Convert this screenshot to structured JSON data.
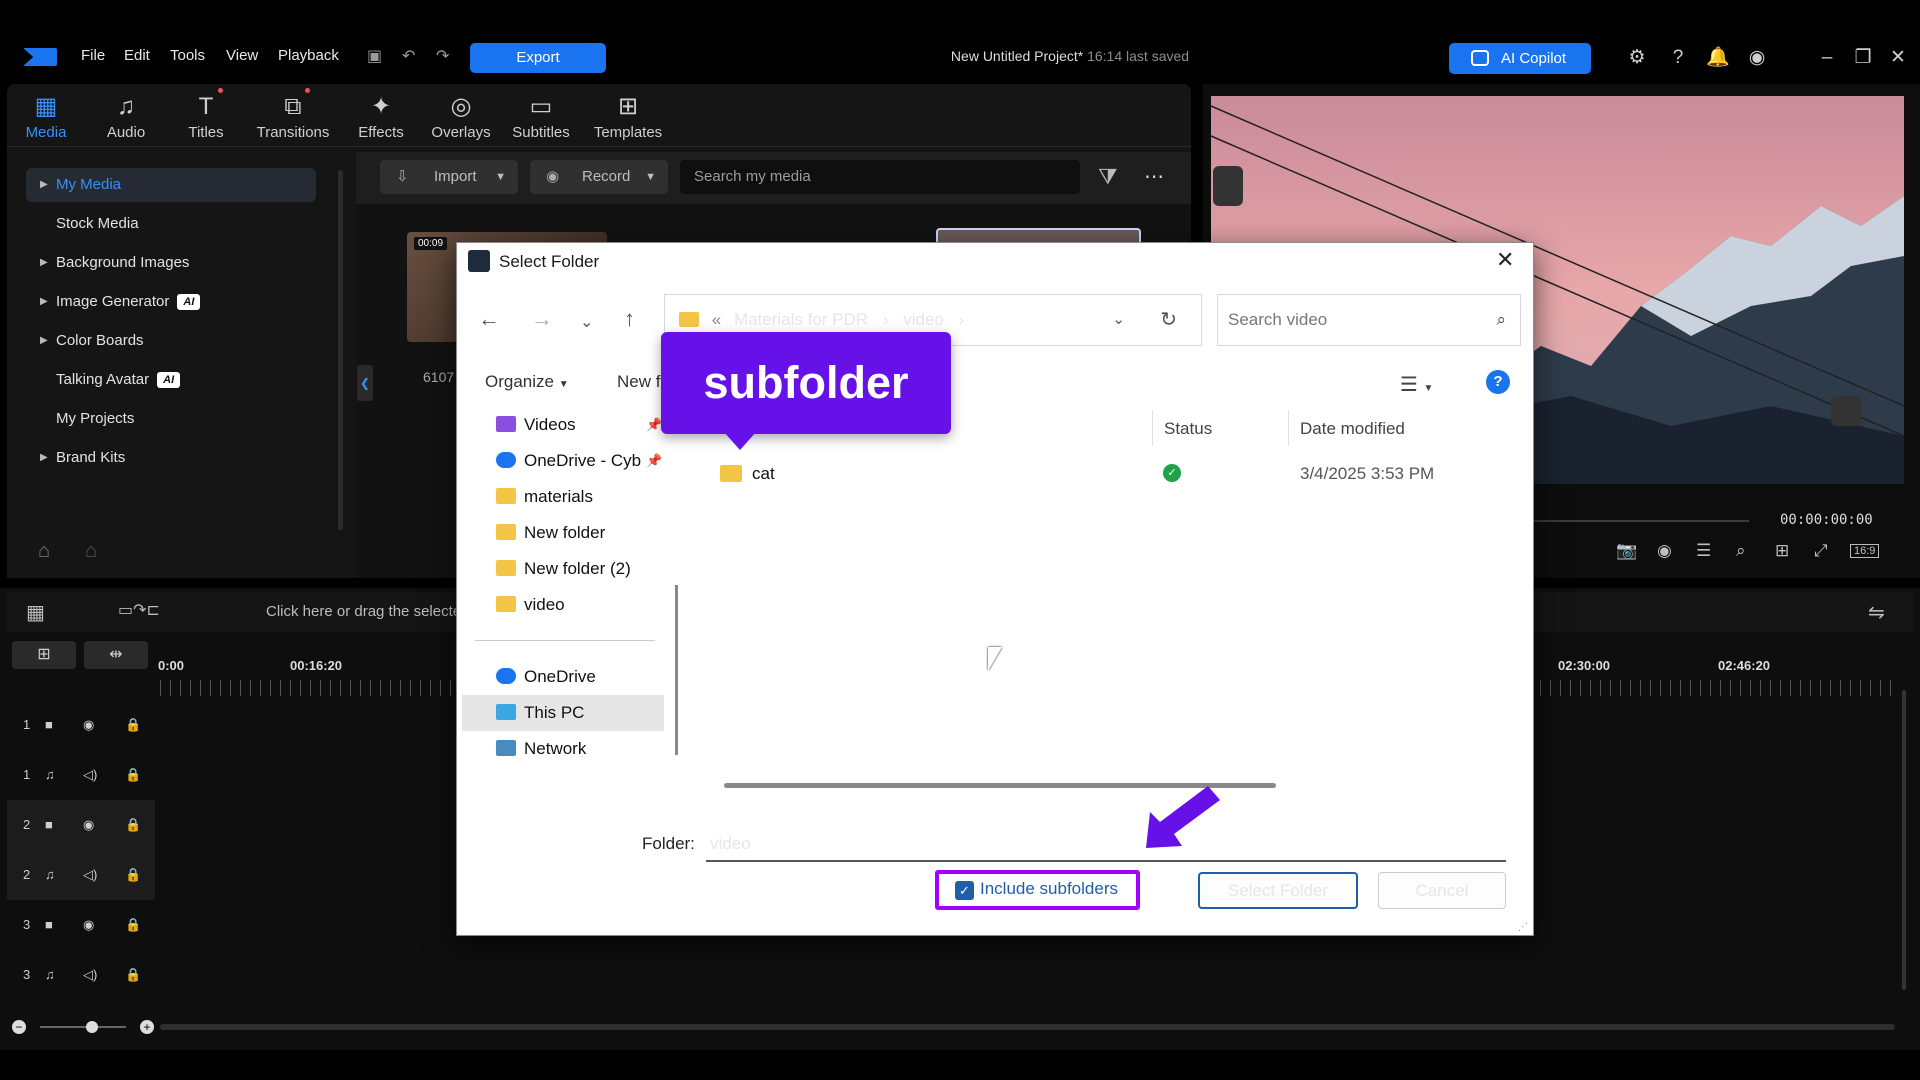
{
  "menu": {
    "file": "File",
    "edit": "Edit",
    "tools": "Tools",
    "view": "View",
    "playback": "Playback",
    "export": "Export"
  },
  "project": {
    "title": "New Untitled Project*",
    "saved": "16:14 last saved"
  },
  "copilot": "AI Copilot",
  "tabs": [
    "Media",
    "Audio",
    "Titles",
    "Transitions",
    "Effects",
    "Overlays",
    "Subtitles",
    "Templates"
  ],
  "sidebar": {
    "items": [
      {
        "label": "My Media"
      },
      {
        "label": "Stock Media"
      },
      {
        "label": "Background Images"
      },
      {
        "label": "Image Generator",
        "badge": "AI"
      },
      {
        "label": "Color Boards"
      },
      {
        "label": "Talking Avatar",
        "badge": "AI"
      },
      {
        "label": "My Projects"
      },
      {
        "label": "Brand Kits"
      }
    ]
  },
  "media_toolbar": {
    "import": "Import",
    "record": "Record",
    "search_placeholder": "Search my media"
  },
  "thumbs": {
    "duration": "00:09",
    "name": "6107"
  },
  "preview": {
    "timecode": "00:00:00:00",
    "ratio": "16:9"
  },
  "timeline": {
    "hint": "Click here or drag the selecte",
    "ruler": [
      "0:00",
      "00:16:20",
      "02:30:00",
      "02:46:20"
    ],
    "tracks": [
      "1",
      "1",
      "2",
      "2",
      "3",
      "3"
    ]
  },
  "dialog": {
    "title": "Select Folder",
    "breadcrumb": [
      "Materials for PDR",
      "video"
    ],
    "search_placeholder": "Search video",
    "organize": "Organize",
    "new_folder": "New f",
    "nav": [
      "Videos",
      "OneDrive - Cyb",
      "materials",
      "New folder",
      "New folder (2)",
      "video",
      "OneDrive",
      "This PC",
      "Network"
    ],
    "columns": {
      "status": "Status",
      "date": "Date modified"
    },
    "rows": [
      {
        "name": "cat",
        "date": "3/4/2025 3:53 PM"
      }
    ],
    "folder_label": "Folder:",
    "folder_value": "video",
    "include_subfolders": "Include subfolders",
    "select_button": "Select Folder",
    "cancel_button": "Cancel"
  },
  "callout": "subfolder",
  "colors": {
    "accent": "#1a74f0",
    "callout": "#6511e8",
    "highlight": "#a400ff"
  }
}
